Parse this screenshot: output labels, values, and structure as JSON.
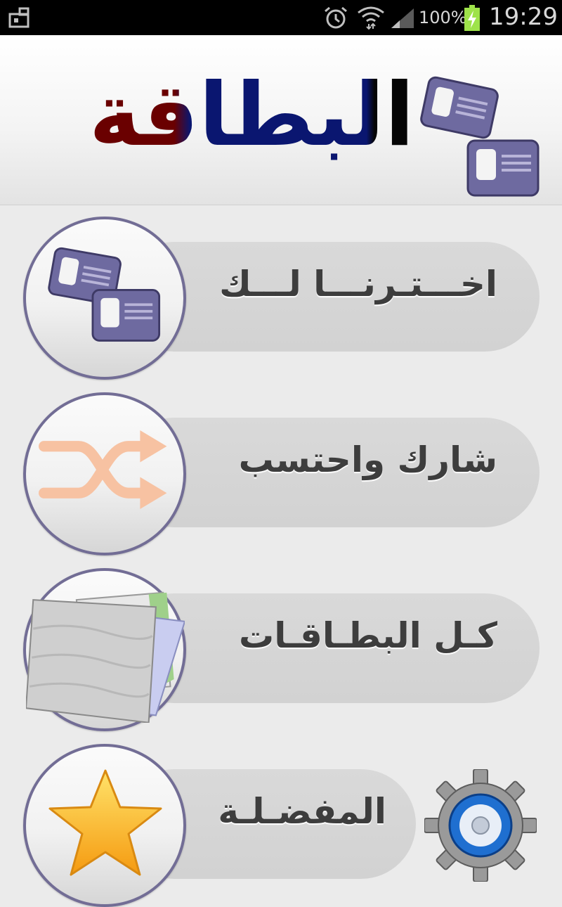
{
  "status_bar": {
    "battery_text": "100%",
    "time": "19:29",
    "icons": [
      "screenshot-icon",
      "alarm-icon",
      "wifi-icon",
      "signal-icon",
      "battery-icon"
    ]
  },
  "header": {
    "logo_text": "البطاقة",
    "logo_icon": "cards-icon",
    "colors": {
      "brand_dark_red": "#6a0000",
      "brand_navy": "#0a1670",
      "icon_purple": "#6e6aa0"
    }
  },
  "menu": {
    "items": [
      {
        "label": "اخـــتـرنـــا لـــك",
        "icon": "id-cards-icon"
      },
      {
        "label": "شارك واحتسب",
        "icon": "shuffle-icon"
      },
      {
        "label": "كـل البطـاقـات",
        "icon": "folder-icon"
      },
      {
        "label": "المفضـلـة",
        "icon": "star-icon"
      }
    ]
  },
  "settings": {
    "icon": "gear-icon"
  }
}
